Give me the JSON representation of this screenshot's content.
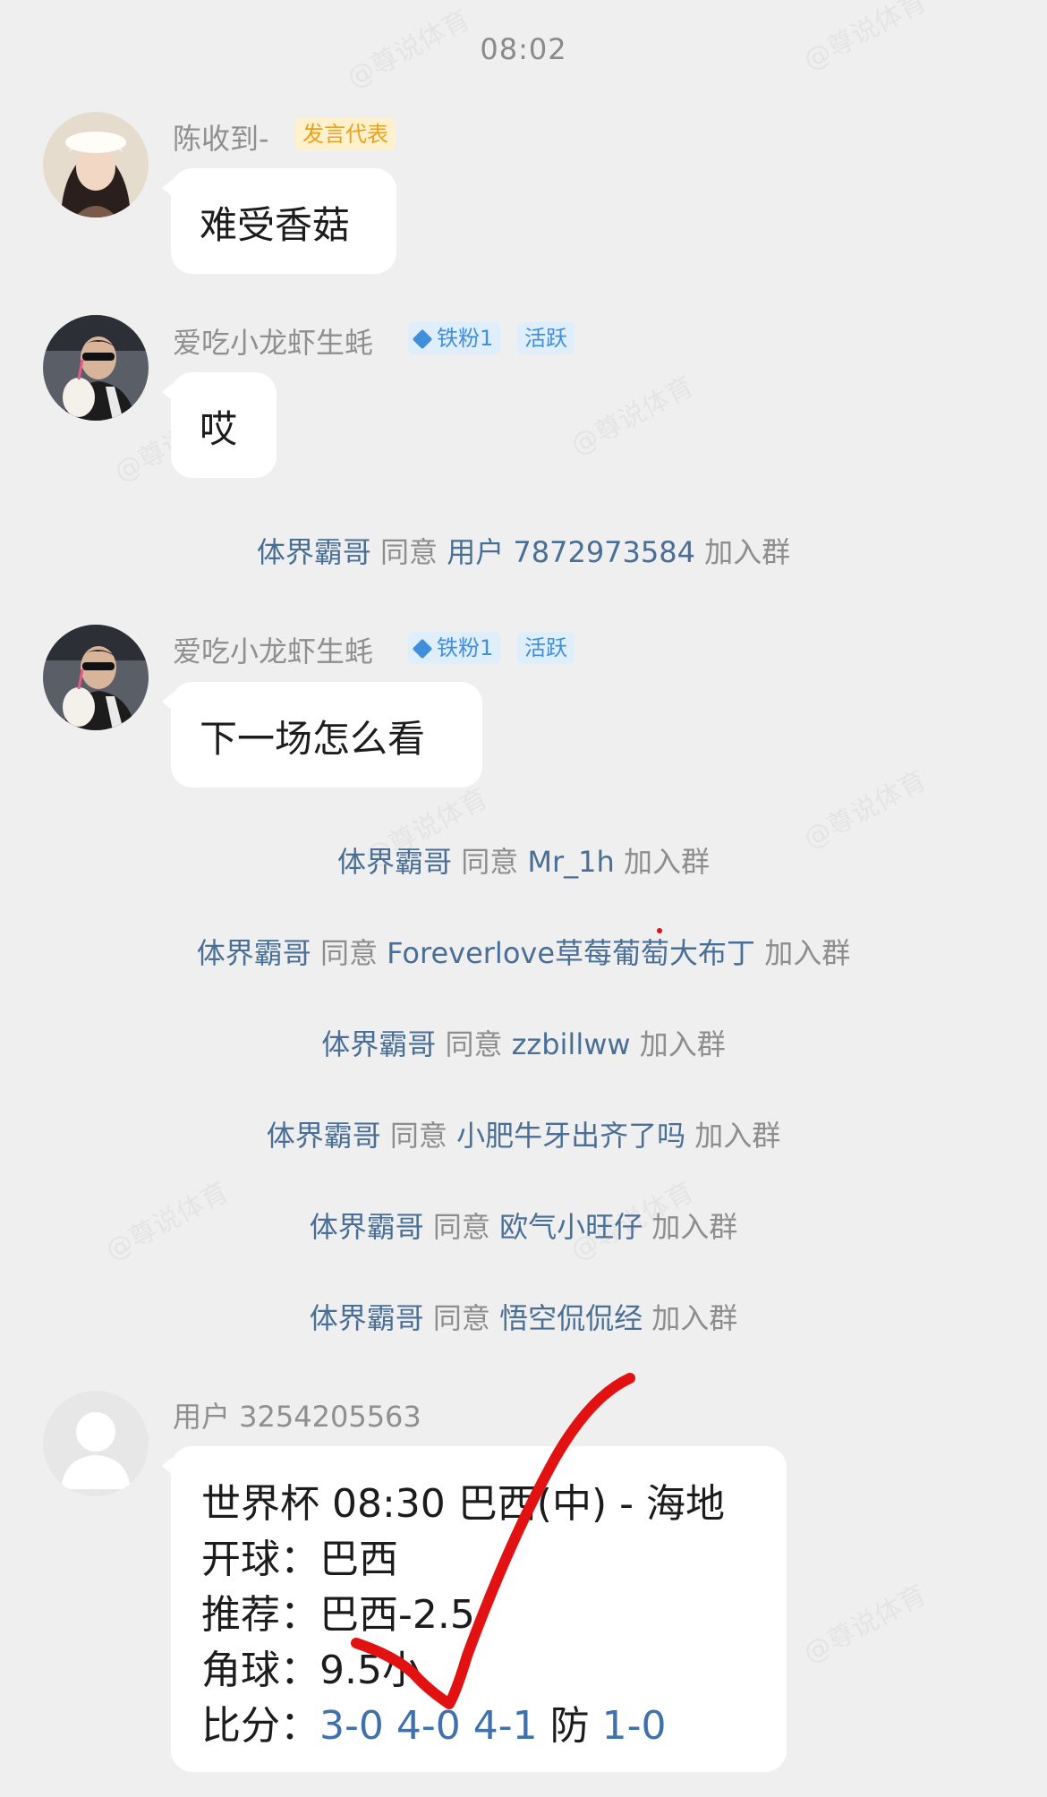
{
  "time": "08:02",
  "watermark": "@尊说体育",
  "messages": [
    {
      "sender": "陈收到-",
      "badge": "发言代表",
      "text": "难受香菇"
    },
    {
      "sender": "爱吃小龙虾生蚝",
      "badge_fan": "铁粉1",
      "badge_active": "活跃",
      "text": "哎"
    },
    {
      "sender": "爱吃小龙虾生蚝",
      "badge_fan": "铁粉1",
      "badge_active": "活跃",
      "text": "下一场怎么看"
    }
  ],
  "system": [
    {
      "admin": "体界霸哥",
      "verb": "同意",
      "user": "用户 7872973584",
      "tail": "加入群"
    },
    {
      "admin": "体界霸哥",
      "verb": "同意",
      "user": "Mr_1h",
      "tail": "加入群"
    },
    {
      "admin": "体界霸哥",
      "verb": "同意",
      "user": "Foreverlove草莓葡萄大布丁",
      "tail": "加入群"
    },
    {
      "admin": "体界霸哥",
      "verb": "同意",
      "user": "zzbillww",
      "tail": "加入群"
    },
    {
      "admin": "体界霸哥",
      "verb": "同意",
      "user": "小肥牛牙出齐了吗",
      "tail": "加入群"
    },
    {
      "admin": "体界霸哥",
      "verb": "同意",
      "user": "欧气小旺仔",
      "tail": "加入群"
    },
    {
      "admin": "体界霸哥",
      "verb": "同意",
      "user": "悟空侃侃经",
      "tail": "加入群"
    }
  ],
  "card": {
    "sender": "用户 3254205563",
    "line1": "世界杯 08:30 巴西(中) - 海地",
    "line2_label": "开球：",
    "line2_value": "巴西",
    "line3_label": "推荐：",
    "line3_value": "巴西-2.5",
    "line4_label": "角球：",
    "line4_value": "9.5小",
    "line5_label": "比分：",
    "scores": [
      "3-0",
      "4-0",
      "4-1"
    ],
    "guard_label": "防",
    "guard_score": "1-0"
  }
}
